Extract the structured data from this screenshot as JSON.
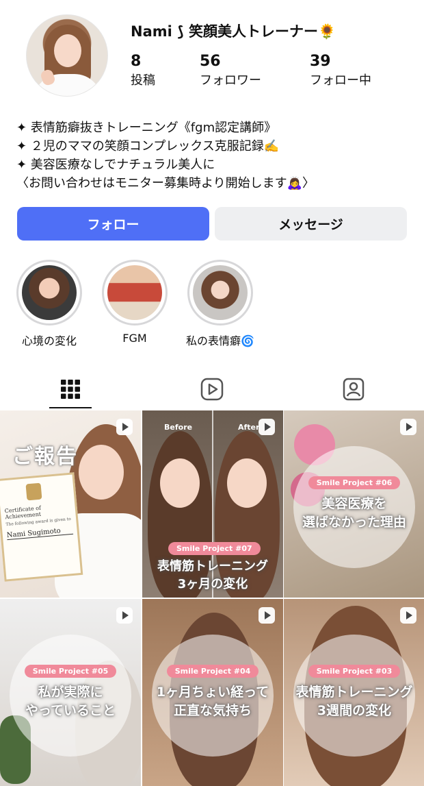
{
  "profile": {
    "username": "Nami ⟆ 笑顔美人トレーナー🌻",
    "stats": [
      {
        "num": "8",
        "label": "投稿"
      },
      {
        "num": "56",
        "label": "フォロワー"
      },
      {
        "num": "39",
        "label": "フォロー中"
      }
    ],
    "bio": [
      "✦ 表情筋癖抜きトレーニング《fgm認定講師》",
      "✦ ２児のママの笑顔コンプレックス克服記録✍️",
      "✦ 美容医療なしでナチュラル美人に",
      "〈お問い合わせはモニター募集時より開始します🙇‍♀️〉"
    ]
  },
  "buttons": {
    "follow": "フォロー",
    "message": "メッセージ"
  },
  "highlights": [
    {
      "label": "心境の変化"
    },
    {
      "label": "FGM"
    },
    {
      "label": "私の表情癖🌀"
    }
  ],
  "posts": [
    {
      "title": "ご報告",
      "cert_title": "Certificate of Achievement",
      "cert_sub": "The following award is given to",
      "cert_name": "Nami Sugimoto"
    },
    {
      "before": "Before",
      "after": "After",
      "tag": "Smile Project #07",
      "text": [
        "表情筋トレーニング",
        "3ヶ月の変化"
      ]
    },
    {
      "tag": "Smile Project #06",
      "text": [
        "美容医療を",
        "選ばなかった理由"
      ]
    },
    {
      "tag": "Smile Project #05",
      "text": [
        "私が実際に",
        "やっていること"
      ]
    },
    {
      "tag": "Smile Project #04",
      "text": [
        "1ヶ月ちょい経って",
        "正直な気持ち"
      ]
    },
    {
      "tag": "Smile Project #03",
      "text": [
        "表情筋トレーニング",
        "3週間の変化"
      ]
    }
  ],
  "colors": {
    "accent": "#4f6ff6",
    "tag": "#f08a9a"
  }
}
